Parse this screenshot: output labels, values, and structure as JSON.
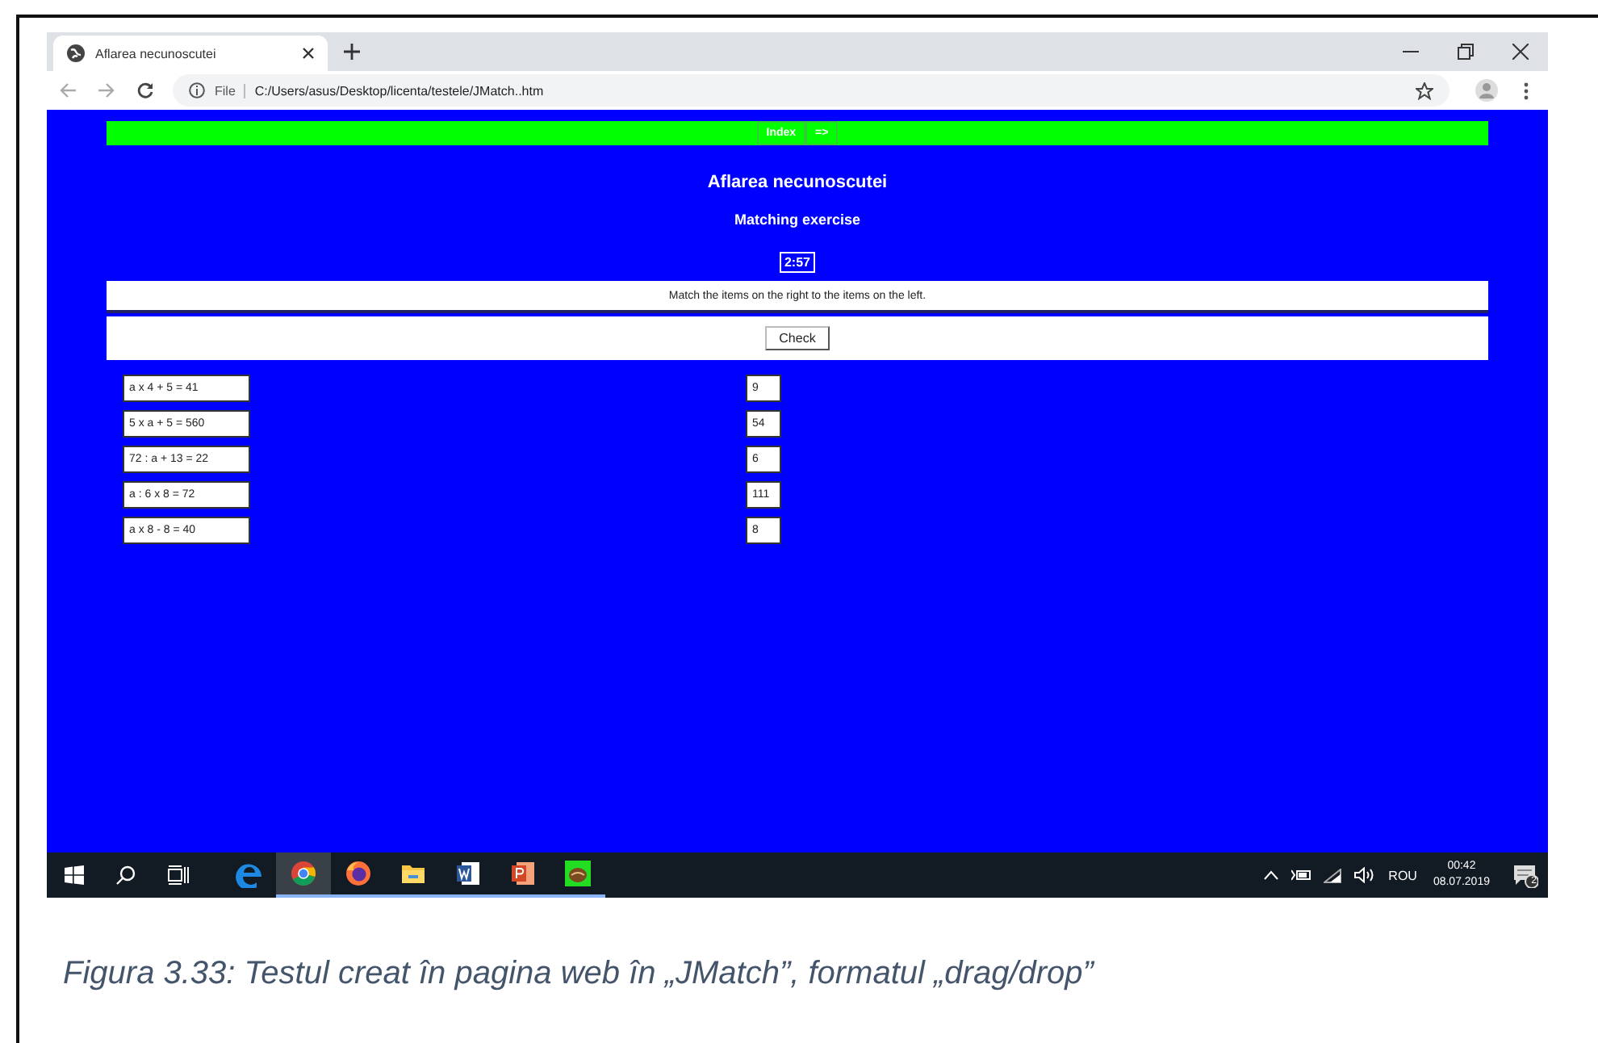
{
  "browser": {
    "tab_title": "Aflarea necunoscutei",
    "url_scheme": "File",
    "url": "C:/Users/asus/Desktop/licenta/testele/JMatch..htm"
  },
  "page": {
    "nav_buttons": [
      "Index",
      "=>"
    ],
    "title": "Aflarea necunoscutei",
    "subtitle": "Matching exercise",
    "timer": "2:57",
    "instructions": "Match the items on the right to the items on the left.",
    "check_button": "Check",
    "left_items": [
      "a x 4 + 5 = 41",
      "5 x a + 5 = 560",
      "72 : a + 13 = 22",
      "a : 6 x 8 = 72",
      "a x 8 - 8 = 40"
    ],
    "right_items": [
      "9",
      "54",
      "6",
      "111",
      "8"
    ]
  },
  "taskbar": {
    "apps": [
      {
        "kind": "edge",
        "selected": false,
        "open": false
      },
      {
        "kind": "chrome",
        "selected": true,
        "open": true
      },
      {
        "kind": "firefox",
        "selected": false,
        "open": true
      },
      {
        "kind": "folder",
        "selected": false,
        "open": true
      },
      {
        "kind": "word",
        "selected": false,
        "open": true
      },
      {
        "kind": "powerpoint",
        "selected": false,
        "open": true
      },
      {
        "kind": "app",
        "selected": false,
        "open": true
      }
    ],
    "language": "ROU",
    "time": "00:42",
    "date": "08.07.2019",
    "notifications": "2"
  },
  "caption": "Figura 3.33: Testul creat în pagina web în „JMatch”, formatul „drag/drop”"
}
